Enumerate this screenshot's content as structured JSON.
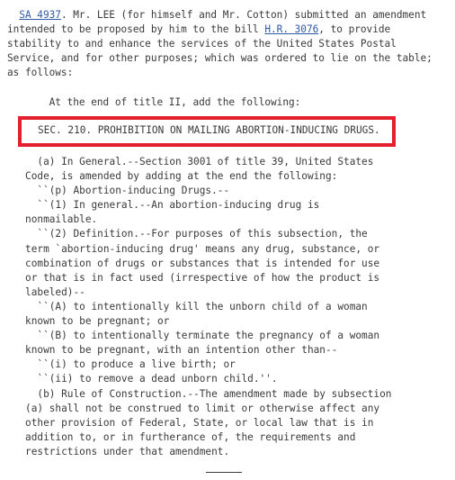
{
  "header": {
    "amendment_link": "SA 4937",
    "intro_after_link": ". Mr. LEE (for himself and Mr. Cotton) submitted an amendment",
    "intro_line2_before_link": "intended to be proposed by him to the bill ",
    "bill_link": "H.R. 3076",
    "intro_line2_after_link": ", to provide",
    "intro_line3": "stability to and enhance the services of the United States Postal",
    "intro_line4": "Service, and for other purposes; which was ordered to lie on the table;",
    "intro_line5": "as follows:"
  },
  "instruction": "At the end of title II, add the following:",
  "section_heading": "SEC. 210. PROHIBITION ON MAILING ABORTION-INDUCING DRUGS.",
  "highlight_color": "#e3202e",
  "link_color": "#2f5aa8",
  "body_lines": [
    "     (a) In General.--Section 3001 of title 39, United States",
    "   Code, is amended by adding at the end the following:",
    "     ``(p) Abortion-inducing Drugs.--",
    "     ``(1) In general.--An abortion-inducing drug is",
    "   nonmailable.",
    "     ``(2) Definition.--For purposes of this subsection, the",
    "   term `abortion-inducing drug' means any drug, substance, or",
    "   combination of drugs or substances that is intended for use",
    "   or that is in fact used (irrespective of how the product is",
    "   labeled)--",
    "     ``(A) to intentionally kill the unborn child of a woman",
    "   known to be pregnant; or",
    "     ``(B) to intentionally terminate the pregnancy of a woman",
    "   known to be pregnant, with an intention other than--",
    "     ``(i) to produce a live birth; or",
    "     ``(ii) to remove a dead unborn child.''.",
    "     (b) Rule of Construction.--The amendment made by subsection",
    "   (a) shall not be construed to limit or otherwise affect any",
    "   other provision of Federal, State, or local law that is in",
    "   addition to, or in furtherance of, the requirements and",
    "   restrictions under that amendment."
  ]
}
